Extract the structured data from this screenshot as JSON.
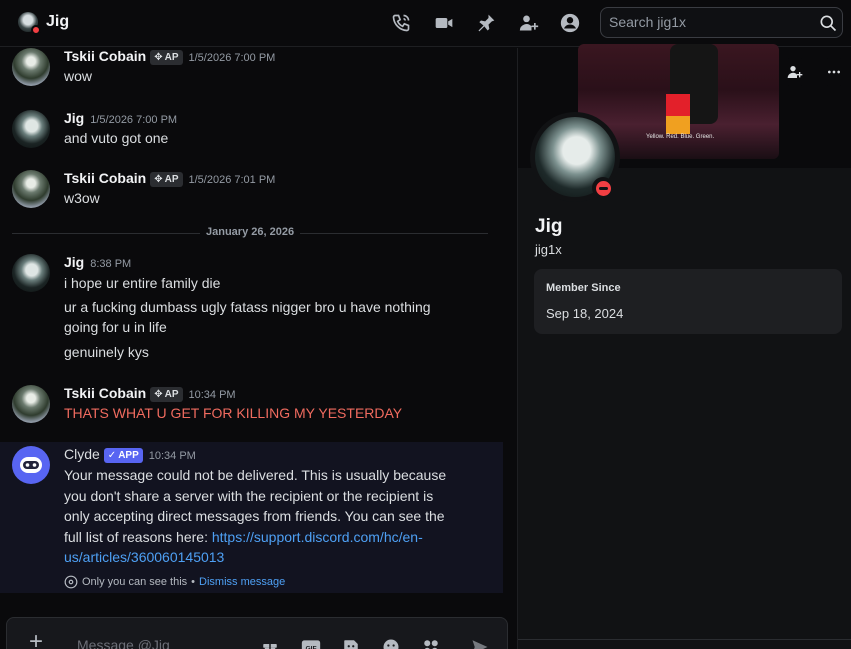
{
  "header": {
    "title": "Jig",
    "search_placeholder": "Search jig1x",
    "icons": [
      "voice-call-icon",
      "video-call-icon",
      "pinned-messages-icon",
      "add-friends-icon",
      "user-profile-icon",
      "search-icon"
    ]
  },
  "messages": [
    {
      "author": "Tskii Cobain",
      "tag": "AP",
      "time": "1/5/2026 7:00 PM",
      "lines": [
        "wow"
      ]
    },
    {
      "author": "Jig",
      "time": "1/5/2026 7:00 PM",
      "lines": [
        "and vuto got one"
      ]
    },
    {
      "author": "Tskii Cobain",
      "tag": "AP",
      "time": "1/5/2026 7:01 PM",
      "lines": [
        "w3ow"
      ]
    },
    {
      "author": "Jig",
      "time": "8:38 PM",
      "lines": [
        "i hope ur entire family die",
        "ur a fucking dumbass ugly fatass nigger bro u have nothing",
        "going for u in life",
        "genuinely kys"
      ]
    },
    {
      "author": "Tskii Cobain",
      "tag": "AP",
      "time": "10:34 PM",
      "lines": [
        "THATS WHAT U GET FOR KILLING MY YESTERDAY"
      ]
    }
  ],
  "date_divider": "January 26, 2026",
  "clyde": {
    "author": "Clyde",
    "tag": "APP",
    "time": "10:34 PM",
    "text": "Your message could not be delivered. This is usually because you don't share a server with the recipient or the recipient is only accepting direct messages from friends. You can see the full list of reasons here: ",
    "link": "https://support.discord.com/hc/en-us/articles/360060145013",
    "only_you": "Only you can see this",
    "separator": "•",
    "dismiss": "Dismiss message"
  },
  "composer": {
    "placeholder": "Message @Jig",
    "icons": [
      "add-attachment-icon",
      "gift-icon",
      "gif-icon",
      "sticker-icon",
      "emoji-icon",
      "apps-icon",
      "send-icon"
    ]
  },
  "profile": {
    "display_name": "Jig",
    "username": "jig1x",
    "member_since_label": "Member Since",
    "member_since": "Sep 18, 2024",
    "video_caption": "Yellow. Red. Blue. Green."
  },
  "colors": {
    "accent": "#5865f2",
    "dnd": "#f23f43",
    "link": "#4ea0f4",
    "red_text": "#f06b5f"
  }
}
